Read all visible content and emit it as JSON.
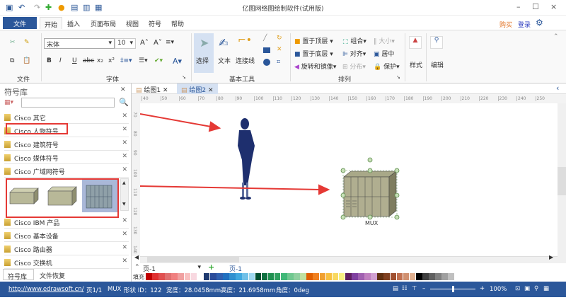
{
  "window": {
    "title": "亿图网络图绘制软件(试用版)",
    "minimize": "–",
    "maximize": "☐",
    "close": "×"
  },
  "menu": {
    "file": "文件",
    "tabs": [
      "开始",
      "插入",
      "页面布局",
      "视图",
      "符号",
      "帮助"
    ],
    "buy": "购买",
    "login": "登录",
    "settings": "⚙"
  },
  "ribbon": {
    "font_name": "宋体",
    "font_size": "10",
    "groups": [
      "文件",
      "字体",
      "基本工具",
      "排列"
    ],
    "tools": {
      "select": "选择",
      "text": "文本",
      "connector": "连接线"
    },
    "arrange": [
      "置于顶层",
      "置于底层",
      "旋转和镜像",
      "组合",
      "对齐",
      "分布",
      "大小",
      "居中",
      "保护"
    ],
    "style": "样式",
    "edit": "编辑",
    "format_buttons": [
      "B",
      "I",
      "U",
      "abc",
      "x₂",
      "x²"
    ]
  },
  "library": {
    "title": "符号库",
    "search_placeholder": "",
    "items": [
      "Cisco 其它",
      "Cisco 人物符号",
      "Cisco 建筑符号",
      "Cisco 媒体符号",
      "Cisco 广域网符号",
      "Cisco IBM 产品",
      "Cisco 基本设备",
      "Cisco 路由器",
      "Cisco 交换机"
    ],
    "bottom_tabs": [
      "符号库",
      "文件恢复"
    ]
  },
  "doc_tabs": [
    "绘图1",
    "绘图2"
  ],
  "ruler_h": [
    "40",
    "50",
    "60",
    "70",
    "80",
    "90",
    "100",
    "110",
    "120",
    "130",
    "140",
    "150",
    "160",
    "170",
    "180",
    "190",
    "200",
    "210",
    "220",
    "230",
    "240",
    "250"
  ],
  "ruler_v": [
    "70",
    "80",
    "90",
    "100",
    "110",
    "120",
    "130",
    "140"
  ],
  "shape_label": "MUX",
  "page": {
    "selector": "页-1",
    "tab": "页-1",
    "fill_label": "填充"
  },
  "palette": [
    "#c00000",
    "#e03030",
    "#e05050",
    "#e07070",
    "#f08080",
    "#f0a0a0",
    "#f8c0c0",
    "#f8d8e0",
    "#ffffff",
    "#1f3a70",
    "#2b4c9a",
    "#3060b0",
    "#2070c0",
    "#3090d0",
    "#40a8e0",
    "#70c0e8",
    "#a0d8f0",
    "#005030",
    "#107040",
    "#209050",
    "#30a060",
    "#40b878",
    "#70c890",
    "#90d0a0",
    "#c0e0a0",
    "#e06000",
    "#f08020",
    "#f0a030",
    "#f8c040",
    "#f8d860",
    "#f8f080",
    "#602060",
    "#8040a0",
    "#a060b0",
    "#c080c0",
    "#d0a0d0",
    "#603010",
    "#804020",
    "#a05030",
    "#c07050",
    "#d09070",
    "#e0b090",
    "#000000",
    "#404040",
    "#606060",
    "#808080",
    "#a0a0a0",
    "#c0c0c0"
  ],
  "status": {
    "url": "http://www.edrawsoft.cn/",
    "page": "页1/1",
    "shape": "MUX",
    "shape_id": "形状 ID：122",
    "width": "宽度：28.0458mm",
    "height": "高度：21.6958mm",
    "angle": "角度：0deg",
    "zoom": "100%",
    "zoom_level": 0.5
  }
}
